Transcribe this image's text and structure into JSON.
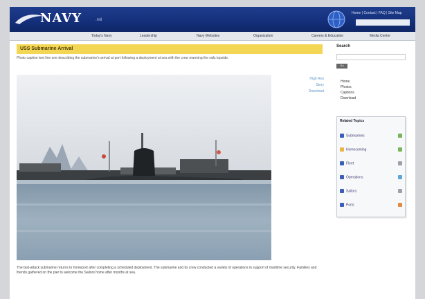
{
  "header": {
    "logo": "NAVY",
    "logo_sub": ".mil",
    "links": "Home | Contact | FAQ | Site Map",
    "search_placeholder": ""
  },
  "nav": {
    "items": [
      "Today's Navy",
      "Leadership",
      "Navy Websites",
      "Organization",
      "Careers & Education",
      "Media Center"
    ]
  },
  "article": {
    "title": "USS Submarine Arrival",
    "caption_top": "Photo caption text line one describing the submarine's arrival at port following a deployment at sea with the crew manning the rails topside.",
    "side_links": [
      "High Res",
      "Story",
      "Download"
    ],
    "body": "The fast-attack submarine returns to homeport after completing a scheduled deployment. The submarine and its crew conducted a variety of operations in support of maritime security. Families and friends gathered on the pier to welcome the Sailors home after months at sea."
  },
  "right": {
    "search_label": "Search",
    "search_button": "Go",
    "list": [
      "Home",
      "Photos",
      "Captions",
      "Download"
    ],
    "topics_head": "Related Topics",
    "topics": [
      "Submarines",
      "Homecoming",
      "Fleet",
      "Operations",
      "Sailors",
      "Ports"
    ],
    "topics_right": [
      "",
      "",
      "",
      "",
      "",
      ""
    ]
  },
  "colors": {
    "header_bg": "#1a3680",
    "title_bar": "#f3d653",
    "link": "#5f95c8"
  }
}
